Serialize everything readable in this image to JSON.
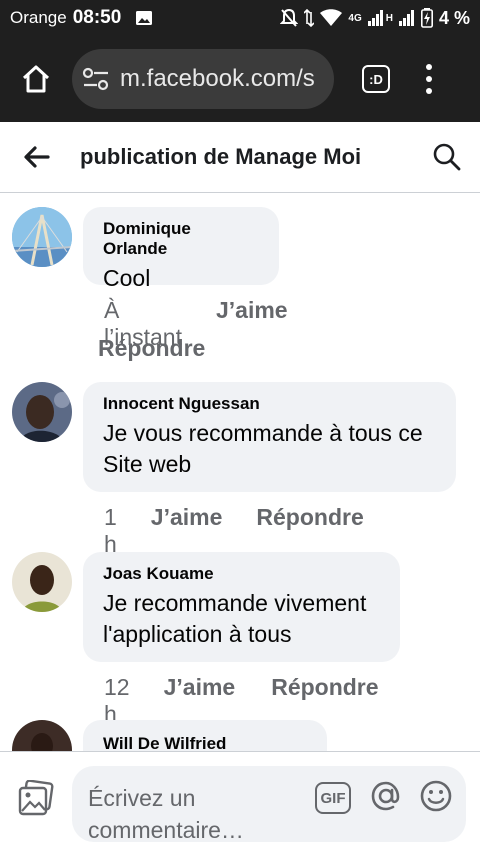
{
  "status_bar": {
    "carrier": "Orange",
    "time": "08:50",
    "network": "4G",
    "network_h": "H",
    "battery": "4 %"
  },
  "browser": {
    "url": "m.facebook.com/s",
    "tabs_label": ":D"
  },
  "header": {
    "title": "publication de Manage Moi"
  },
  "comments": [
    {
      "author": "Dominique Orlande",
      "lines": [
        "Cool"
      ],
      "time": "À l’instant",
      "like": "J’aime",
      "reply": "Répondre"
    },
    {
      "author": "Innocent Nguessan",
      "lines": [
        "Je vous recommande à tous ce",
        "Site web"
      ],
      "time": "1 h",
      "like": "J’aime",
      "reply": "Répondre"
    },
    {
      "author": "Joas Kouame",
      "lines": [
        "Je recommande vivement",
        "l'application à tous"
      ],
      "time": "12 h",
      "like": "J’aime",
      "reply": "Répondre"
    },
    {
      "author": "Will De Wilfried",
      "lines": [],
      "time": "",
      "like": "",
      "reply": ""
    }
  ],
  "composer": {
    "placeholder_line1": "Écrivez un",
    "placeholder_line2": "commentaire…",
    "gif_label": "GIF"
  },
  "colors": {
    "bar_bg": "#1f1f1f",
    "bubble_bg": "#f0f2f5",
    "secondary_text": "#65676b"
  }
}
